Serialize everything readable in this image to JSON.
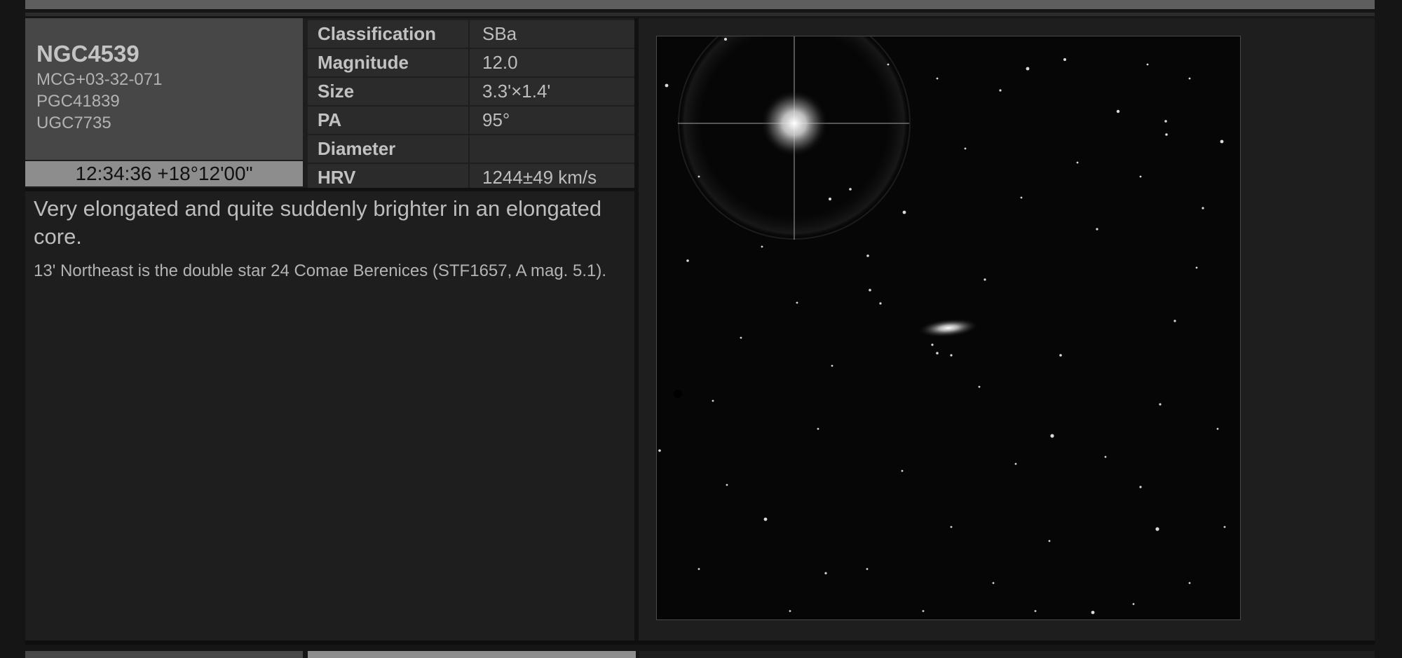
{
  "object": {
    "name": "NGC4539",
    "aliases": [
      "MCG+03-32-071",
      "PGC41839",
      "UGC7735"
    ],
    "coordinates": "12:34:36 +18°12'00\""
  },
  "attributes": [
    {
      "label": "Classification",
      "value": "SBa"
    },
    {
      "label": "Magnitude",
      "value": "12.0"
    },
    {
      "label": "Size",
      "value": "3.3'×1.4'"
    },
    {
      "label": "PA",
      "value": "95°"
    },
    {
      "label": "Diameter",
      "value": ""
    },
    {
      "label": "HRV",
      "value": "1244±49 km/s"
    }
  ],
  "description": {
    "lead": "Very elongated and quite suddenly brighter in an elongated core.",
    "note": "13' Northeast is the double star 24 Comae Berenices (STF1657, A mag. 5.1)."
  }
}
